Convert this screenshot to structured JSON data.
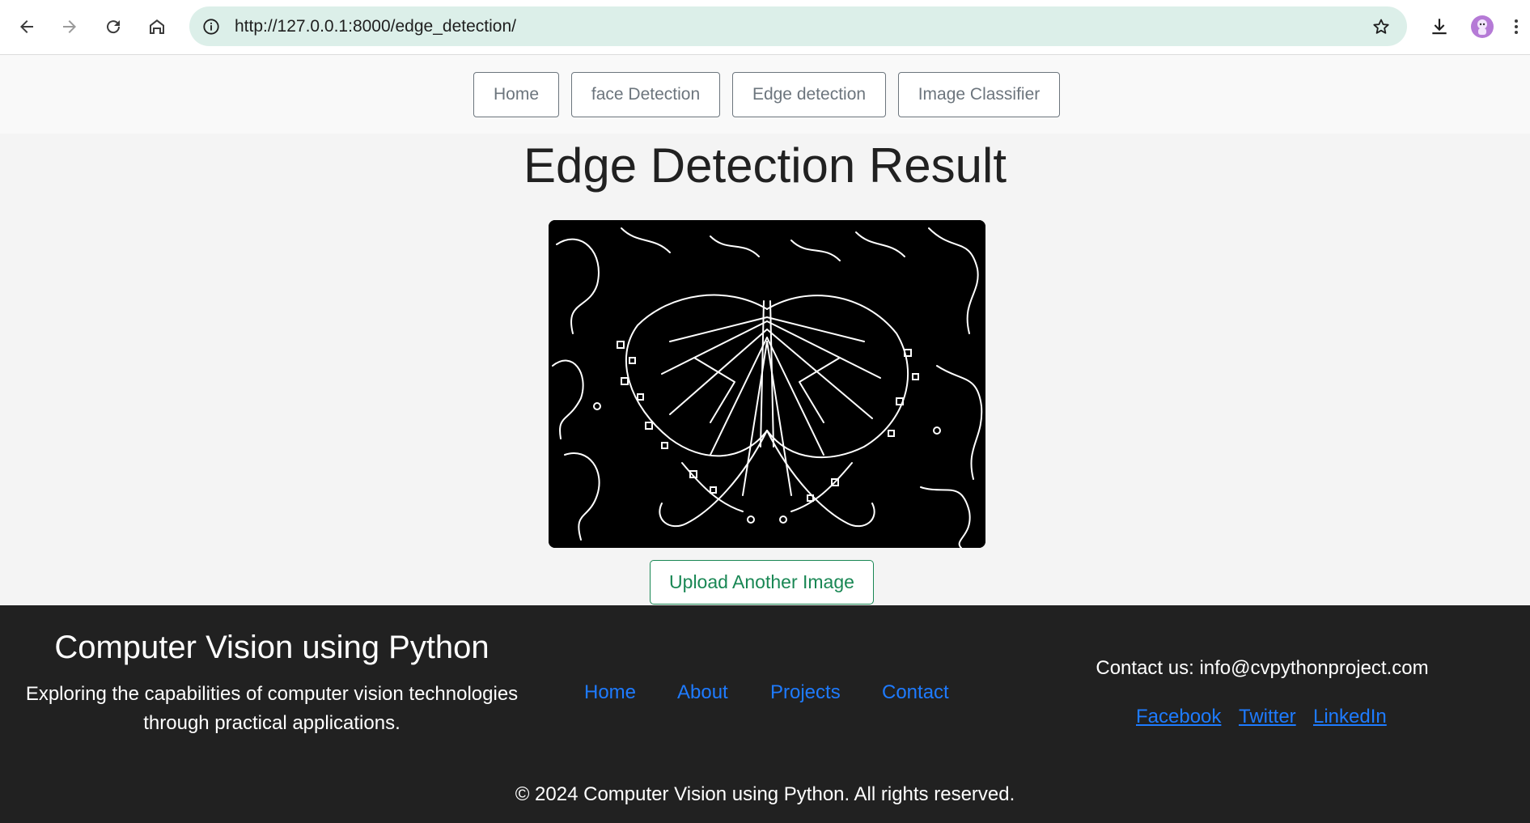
{
  "browser": {
    "url": "http://127.0.0.1:8000/edge_detection/",
    "icons": [
      "back-arrow-icon",
      "forward-arrow-icon",
      "reload-icon",
      "home-icon",
      "site-info-icon",
      "bookmark-star-icon",
      "download-icon",
      "profile-avatar-icon",
      "kebab-menu-icon"
    ]
  },
  "nav": {
    "items": [
      {
        "label": "Home"
      },
      {
        "label": "face Detection"
      },
      {
        "label": "Edge detection"
      },
      {
        "label": "Image Classifier"
      }
    ]
  },
  "main": {
    "title": "Edge Detection Result",
    "upload_button": "Upload Another Image"
  },
  "footer": {
    "title": "Computer Vision using Python",
    "description": "Exploring the capabilities of computer vision technologies through practical applications.",
    "links": [
      {
        "label": "Home"
      },
      {
        "label": "About"
      },
      {
        "label": "Projects"
      },
      {
        "label": "Contact"
      }
    ],
    "contact": "Contact us: info@cvpythonproject.com",
    "social": [
      {
        "label": "Facebook"
      },
      {
        "label": "Twitter"
      },
      {
        "label": "LinkedIn"
      }
    ],
    "copyright": "© 2024 Computer Vision using Python. All rights reserved."
  },
  "colors": {
    "link": "#1e7bff",
    "success": "#198754",
    "footer_bg": "#212121",
    "address_bar": "#dcefe9"
  }
}
